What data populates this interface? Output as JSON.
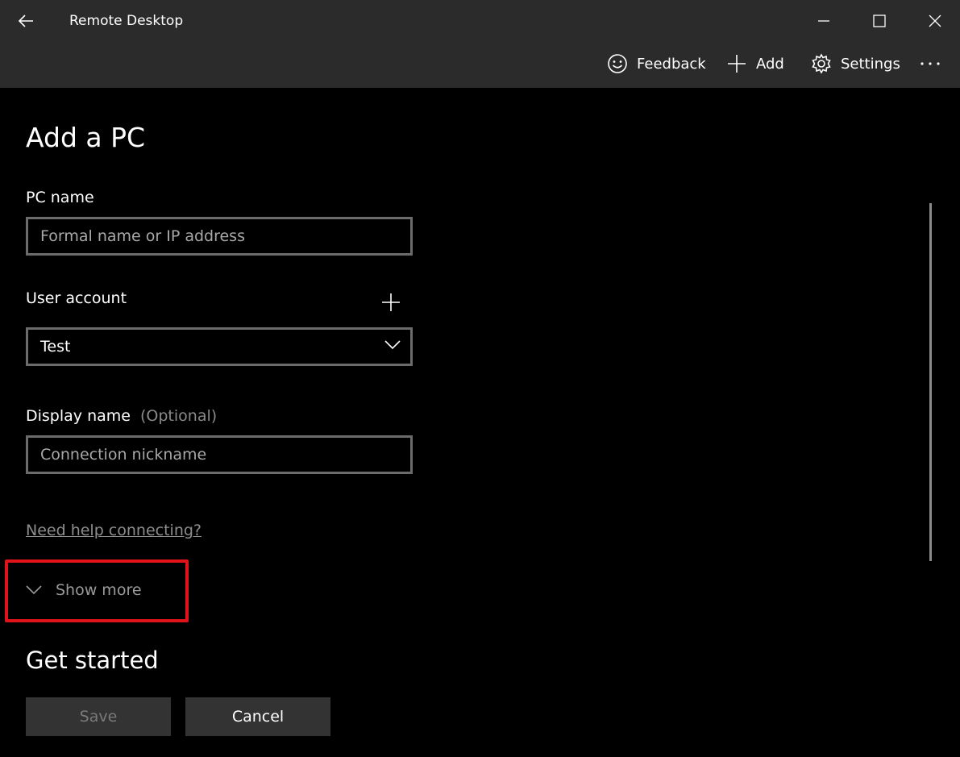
{
  "window": {
    "title": "Remote Desktop",
    "back_icon": "arrow-left-icon",
    "controls": [
      "minimize-icon",
      "maximize-icon",
      "close-icon"
    ]
  },
  "commandbar": {
    "feedback_label": "Feedback",
    "add_label": "Add",
    "settings_label": "Settings",
    "more_icon": "ellipsis-icon"
  },
  "form": {
    "title": "Add a PC",
    "pc_name": {
      "label": "PC name",
      "placeholder": "Formal name or IP address",
      "value": ""
    },
    "user_account": {
      "label": "User account",
      "selected": "Test"
    },
    "display_name": {
      "label": "Display name",
      "optional_label": "(Optional)",
      "placeholder": "Connection nickname",
      "value": ""
    },
    "help_link": "Need help connecting?",
    "show_more_label": "Show more"
  },
  "get_started": {
    "title": "Get started",
    "save_label": "Save",
    "cancel_label": "Cancel"
  },
  "colors": {
    "titlebar_bg": "#2b2b2b",
    "page_bg": "#000000",
    "highlight": "#e0131b",
    "field_border": "#6b6b6b"
  }
}
